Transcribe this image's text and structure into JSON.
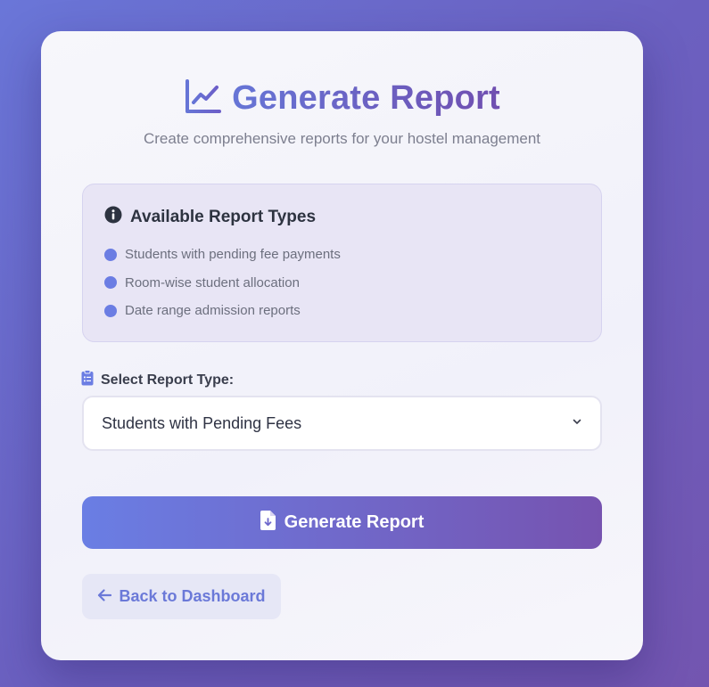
{
  "header": {
    "title": "Generate Report",
    "subtitle": "Create comprehensive reports for your hostel management",
    "icon": "chart-line-icon"
  },
  "info": {
    "icon": "info-circle-icon",
    "title": "Available Report Types",
    "items": [
      "Students with pending fee payments",
      "Room-wise student allocation",
      "Date range admission reports"
    ]
  },
  "form": {
    "label_icon": "clipboard-list-icon",
    "label": "Select Report Type:",
    "selected": "Students with Pending Fees"
  },
  "actions": {
    "generate_icon": "file-download-icon",
    "generate_label": "Generate Report",
    "back_icon": "arrow-left-icon",
    "back_label": "Back to Dashboard"
  },
  "colors": {
    "accent": "#6b7de3",
    "accent_end": "#7653b0",
    "text_dark": "#2d3340",
    "text_muted": "#7d7f8f"
  }
}
